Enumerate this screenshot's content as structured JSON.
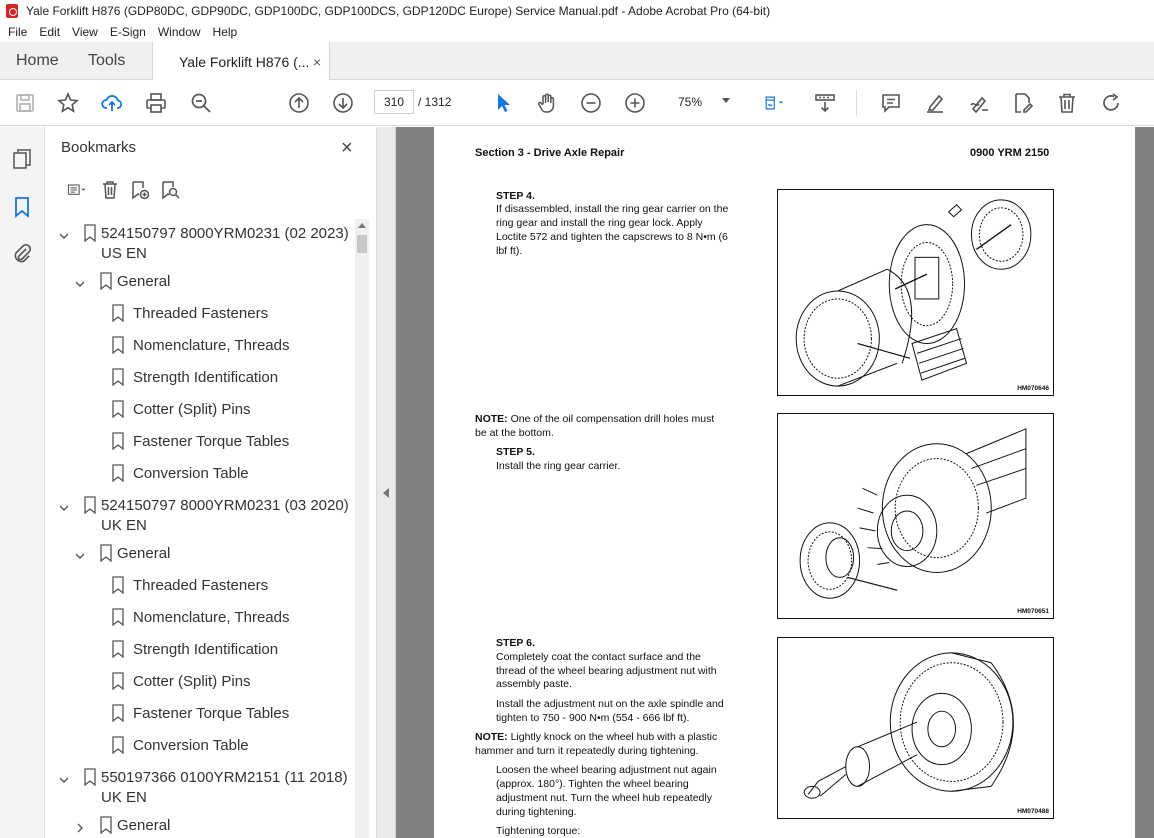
{
  "window": {
    "title": "Yale Forklift H876 (GDP80DC, GDP90DC, GDP100DC, GDP100DCS, GDP120DC Europe) Service Manual.pdf - Adobe Acrobat Pro (64-bit)"
  },
  "menu": [
    "File",
    "Edit",
    "View",
    "E-Sign",
    "Window",
    "Help"
  ],
  "tabs": {
    "home": "Home",
    "tools": "Tools",
    "document": "Yale Forklift H876 (...",
    "close_glyph": "×"
  },
  "toolbar": {
    "current_page": "310",
    "page_total": "/ 1312",
    "zoom": "75%"
  },
  "bookmarks": {
    "title": "Bookmarks",
    "close_glyph": "×",
    "items": [
      {
        "level": 0,
        "expanded": true,
        "label": "524150797 8000YRM0231 (02 2023) US EN"
      },
      {
        "level": 1,
        "expanded": true,
        "label": "General"
      },
      {
        "level": 2,
        "label": "Threaded Fasteners"
      },
      {
        "level": 2,
        "label": "Nomenclature, Threads"
      },
      {
        "level": 2,
        "label": "Strength Identification"
      },
      {
        "level": 2,
        "label": "Cotter (Split) Pins"
      },
      {
        "level": 2,
        "label": "Fastener Torque Tables"
      },
      {
        "level": 2,
        "label": "Conversion Table"
      },
      {
        "level": 0,
        "expanded": true,
        "label": "524150797 8000YRM0231 (03 2020) UK EN"
      },
      {
        "level": 1,
        "expanded": true,
        "label": "General"
      },
      {
        "level": 2,
        "label": "Threaded Fasteners"
      },
      {
        "level": 2,
        "label": "Nomenclature, Threads"
      },
      {
        "level": 2,
        "label": "Strength Identification"
      },
      {
        "level": 2,
        "label": "Cotter (Split) Pins"
      },
      {
        "level": 2,
        "label": "Fastener Torque Tables"
      },
      {
        "level": 2,
        "label": "Conversion Table"
      },
      {
        "level": 0,
        "expanded": true,
        "label": "550197366 0100YRM2151 (11 2018) UK EN"
      },
      {
        "level": 1,
        "expanded": false,
        "label": "General"
      }
    ]
  },
  "page": {
    "header_left": "Section 3 - Drive Axle Repair",
    "header_right": "0900 YRM 2150",
    "step4_title": "STEP 4.",
    "step4_l1": "If disassembled, install the ring gear carrier on the",
    "step4_l2": "ring gear and install the ring gear lock. Apply",
    "step4_l3": "Loctite 572 and tighten the capscrews to 8 N•m (6",
    "step4_l4": "lbf ft).",
    "note1_label": "NOTE:",
    "note1_l1": "One of the oil compensation drill holes must",
    "note1_l2": "be at the bottom.",
    "step5_title": "STEP 5.",
    "step5_l1": "Install the ring gear carrier.",
    "step6_title": "STEP 6.",
    "step6_l1": "Completely coat the contact surface and the",
    "step6_l2": "thread of the wheel bearing adjustment nut with",
    "step6_l3": "assembly paste.",
    "step6_l4": "Install the adjustment nut on the axle spindle and",
    "step6_l5": "tighten to 750 - 900 N•m (554 - 666 lbf ft).",
    "note2_label": "NOTE:",
    "note2_l1": "Lightly knock on the wheel hub with a plastic",
    "note2_l2": "hammer and turn it repeatedly during tightening.",
    "loosen_l1": "Loosen the wheel bearing adjustment nut again",
    "loosen_l2": "(approx. 180°). Tighten the wheel bearing",
    "loosen_l3": "adjustment nut. Turn the wheel hub repeatedly",
    "loosen_l4": "during tightening.",
    "torque_label": "Tightening torque:",
    "fig1_caption": "HM070646",
    "fig2_caption": "HM070651",
    "fig3_caption": "HM070488"
  }
}
